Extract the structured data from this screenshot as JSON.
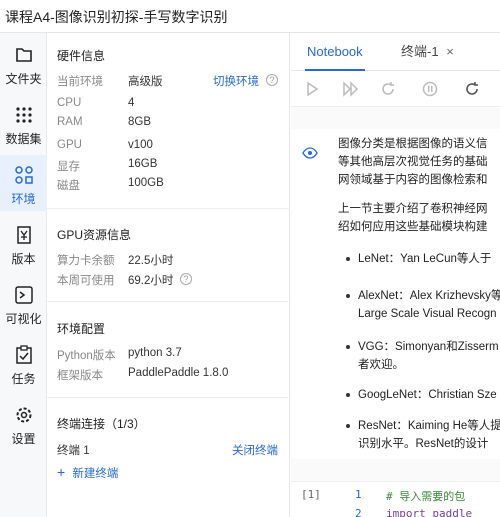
{
  "window": {
    "title": "课程A4-图像识别初探-手写数字识别"
  },
  "nav": [
    {
      "key": "files",
      "label": "文件夹",
      "icon": "folder-icon"
    },
    {
      "key": "datasets",
      "label": "数据集",
      "icon": "grid-icon"
    },
    {
      "key": "env",
      "label": "环境",
      "icon": "env-icon",
      "active": true
    },
    {
      "key": "version",
      "label": "版本",
      "icon": "version-icon"
    },
    {
      "key": "viz",
      "label": "可视化",
      "icon": "chart-icon"
    },
    {
      "key": "tasks",
      "label": "任务",
      "icon": "task-icon"
    },
    {
      "key": "settings",
      "label": "设置",
      "icon": "gear-icon"
    }
  ],
  "hardware": {
    "title": "硬件信息",
    "current_env_label": "当前环境",
    "current_env_value": "高级版",
    "switch_label": "切换环境",
    "rows": [
      {
        "k": "CPU",
        "v": "4"
      },
      {
        "k": "RAM",
        "v": "8GB"
      },
      {
        "k": "GPU",
        "v": "v100"
      },
      {
        "k": "显存",
        "v": "16GB"
      },
      {
        "k": "磁盘",
        "v": "100GB"
      }
    ]
  },
  "gpu": {
    "title": "GPU资源信息",
    "remaining_label": "算力卡余额",
    "remaining_value": "22.5小时",
    "weekly_label": "本周可使用",
    "weekly_value": "69.2小时"
  },
  "envcfg": {
    "title": "环境配置",
    "python_label": "Python版本",
    "python_value": "python 3.7",
    "framework_label": "框架版本",
    "framework_value": "PaddlePaddle 1.8.0"
  },
  "terminal": {
    "title": "终端连接（1/3）",
    "item": "终端 1",
    "close_label": "关闭终端",
    "new_label": "新建终端"
  },
  "tabs": [
    {
      "label": "Notebook",
      "active": true
    },
    {
      "label": "终端-1",
      "close": "×"
    }
  ],
  "notebook": {
    "para1": [
      "图像分类是根据图像的语义信",
      "等其他高层次视觉任务的基础",
      "网领域基于内容的图像检索和"
    ],
    "para2": [
      "上一节主要介绍了卷积神经网",
      "绍如何应用这些基础模块构建"
    ],
    "bullets": [
      [
        "LeNet：Yan LeCun等人于"
      ],
      [
        "AlexNet：Alex Krizhevsky等",
        "Large Scale Visual Recogn"
      ],
      [
        "VGG：Simonyan和Zisserm",
        "者欢迎。"
      ],
      [
        "GoogLeNet：Christian Sze"
      ],
      [
        "ResNet：Kaiming He等人提",
        "识别水平。ResNet的设计"
      ]
    ],
    "code": {
      "exec_count": "[1]",
      "lines": [
        {
          "no": "1",
          "text": "# 导入需要的包"
        },
        {
          "no": "2",
          "text": "import paddle"
        }
      ]
    }
  },
  "colors": {
    "accent": "#2469d6",
    "active_bg": "#e8f0fe",
    "comment": "#3a8a3a",
    "keyword": "#7a3e9d"
  }
}
